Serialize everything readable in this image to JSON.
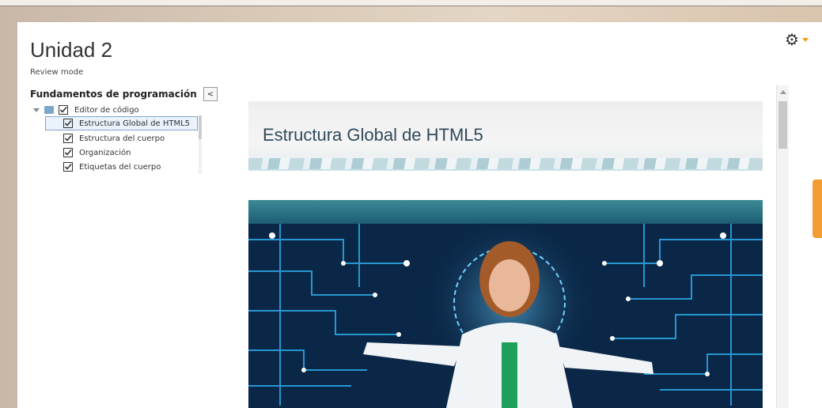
{
  "page": {
    "title": "Unidad 2",
    "subtitle": "Review mode"
  },
  "toolbar": {
    "settings_icon": "gear-icon",
    "accent": "#f39c12"
  },
  "toc": {
    "title": "Fundamentos de programación",
    "collapse_label": "<",
    "folder": "Editor de código",
    "items": [
      {
        "label": "Estructura Global de HTML5",
        "selected": true
      },
      {
        "label": "Estructura del cuerpo",
        "selected": false
      },
      {
        "label": "Organización",
        "selected": false
      },
      {
        "label": "Etiquetas del cuerpo",
        "selected": false
      }
    ]
  },
  "content": {
    "banner_title": "Estructura Global de HTML5",
    "hero_image": "circuit-board-with-avatar-image"
  },
  "colors": {
    "hero_bg": "#0b2a4a",
    "circuit": "#2ba3e0",
    "side_tab": "#f39c32"
  }
}
